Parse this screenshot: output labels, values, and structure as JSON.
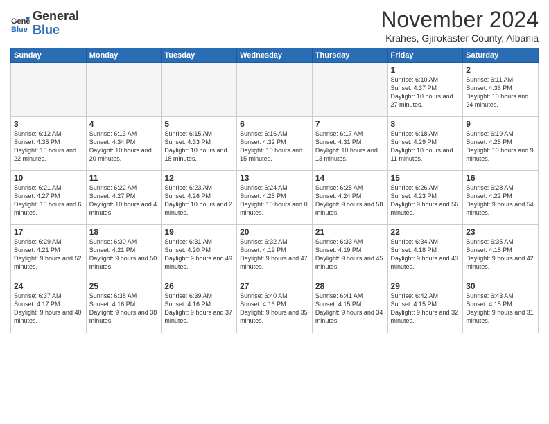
{
  "header": {
    "logo_general": "General",
    "logo_blue": "Blue",
    "month_title": "November 2024",
    "location": "Krahes, Gjirokaster County, Albania"
  },
  "weekdays": [
    "Sunday",
    "Monday",
    "Tuesday",
    "Wednesday",
    "Thursday",
    "Friday",
    "Saturday"
  ],
  "weeks": [
    [
      {
        "day": "",
        "empty": true
      },
      {
        "day": "",
        "empty": true
      },
      {
        "day": "",
        "empty": true
      },
      {
        "day": "",
        "empty": true
      },
      {
        "day": "",
        "empty": true
      },
      {
        "day": "1",
        "sunrise": "6:10 AM",
        "sunset": "4:37 PM",
        "daylight": "10 hours and 27 minutes."
      },
      {
        "day": "2",
        "sunrise": "6:11 AM",
        "sunset": "4:36 PM",
        "daylight": "10 hours and 24 minutes."
      }
    ],
    [
      {
        "day": "3",
        "sunrise": "6:12 AM",
        "sunset": "4:35 PM",
        "daylight": "10 hours and 22 minutes."
      },
      {
        "day": "4",
        "sunrise": "6:13 AM",
        "sunset": "4:34 PM",
        "daylight": "10 hours and 20 minutes."
      },
      {
        "day": "5",
        "sunrise": "6:15 AM",
        "sunset": "4:33 PM",
        "daylight": "10 hours and 18 minutes."
      },
      {
        "day": "6",
        "sunrise": "6:16 AM",
        "sunset": "4:32 PM",
        "daylight": "10 hours and 15 minutes."
      },
      {
        "day": "7",
        "sunrise": "6:17 AM",
        "sunset": "4:31 PM",
        "daylight": "10 hours and 13 minutes."
      },
      {
        "day": "8",
        "sunrise": "6:18 AM",
        "sunset": "4:29 PM",
        "daylight": "10 hours and 11 minutes."
      },
      {
        "day": "9",
        "sunrise": "6:19 AM",
        "sunset": "4:28 PM",
        "daylight": "10 hours and 9 minutes."
      }
    ],
    [
      {
        "day": "10",
        "sunrise": "6:21 AM",
        "sunset": "4:27 PM",
        "daylight": "10 hours and 6 minutes."
      },
      {
        "day": "11",
        "sunrise": "6:22 AM",
        "sunset": "4:27 PM",
        "daylight": "10 hours and 4 minutes."
      },
      {
        "day": "12",
        "sunrise": "6:23 AM",
        "sunset": "4:26 PM",
        "daylight": "10 hours and 2 minutes."
      },
      {
        "day": "13",
        "sunrise": "6:24 AM",
        "sunset": "4:25 PM",
        "daylight": "10 hours and 0 minutes."
      },
      {
        "day": "14",
        "sunrise": "6:25 AM",
        "sunset": "4:24 PM",
        "daylight": "9 hours and 58 minutes."
      },
      {
        "day": "15",
        "sunrise": "6:26 AM",
        "sunset": "4:23 PM",
        "daylight": "9 hours and 56 minutes."
      },
      {
        "day": "16",
        "sunrise": "6:28 AM",
        "sunset": "4:22 PM",
        "daylight": "9 hours and 54 minutes."
      }
    ],
    [
      {
        "day": "17",
        "sunrise": "6:29 AM",
        "sunset": "4:21 PM",
        "daylight": "9 hours and 52 minutes."
      },
      {
        "day": "18",
        "sunrise": "6:30 AM",
        "sunset": "4:21 PM",
        "daylight": "9 hours and 50 minutes."
      },
      {
        "day": "19",
        "sunrise": "6:31 AM",
        "sunset": "4:20 PM",
        "daylight": "9 hours and 49 minutes."
      },
      {
        "day": "20",
        "sunrise": "6:32 AM",
        "sunset": "4:19 PM",
        "daylight": "9 hours and 47 minutes."
      },
      {
        "day": "21",
        "sunrise": "6:33 AM",
        "sunset": "4:19 PM",
        "daylight": "9 hours and 45 minutes."
      },
      {
        "day": "22",
        "sunrise": "6:34 AM",
        "sunset": "4:18 PM",
        "daylight": "9 hours and 43 minutes."
      },
      {
        "day": "23",
        "sunrise": "6:35 AM",
        "sunset": "4:18 PM",
        "daylight": "9 hours and 42 minutes."
      }
    ],
    [
      {
        "day": "24",
        "sunrise": "6:37 AM",
        "sunset": "4:17 PM",
        "daylight": "9 hours and 40 minutes."
      },
      {
        "day": "25",
        "sunrise": "6:38 AM",
        "sunset": "4:16 PM",
        "daylight": "9 hours and 38 minutes."
      },
      {
        "day": "26",
        "sunrise": "6:39 AM",
        "sunset": "4:16 PM",
        "daylight": "9 hours and 37 minutes."
      },
      {
        "day": "27",
        "sunrise": "6:40 AM",
        "sunset": "4:16 PM",
        "daylight": "9 hours and 35 minutes."
      },
      {
        "day": "28",
        "sunrise": "6:41 AM",
        "sunset": "4:15 PM",
        "daylight": "9 hours and 34 minutes."
      },
      {
        "day": "29",
        "sunrise": "6:42 AM",
        "sunset": "4:15 PM",
        "daylight": "9 hours and 32 minutes."
      },
      {
        "day": "30",
        "sunrise": "6:43 AM",
        "sunset": "4:15 PM",
        "daylight": "9 hours and 31 minutes."
      }
    ]
  ]
}
